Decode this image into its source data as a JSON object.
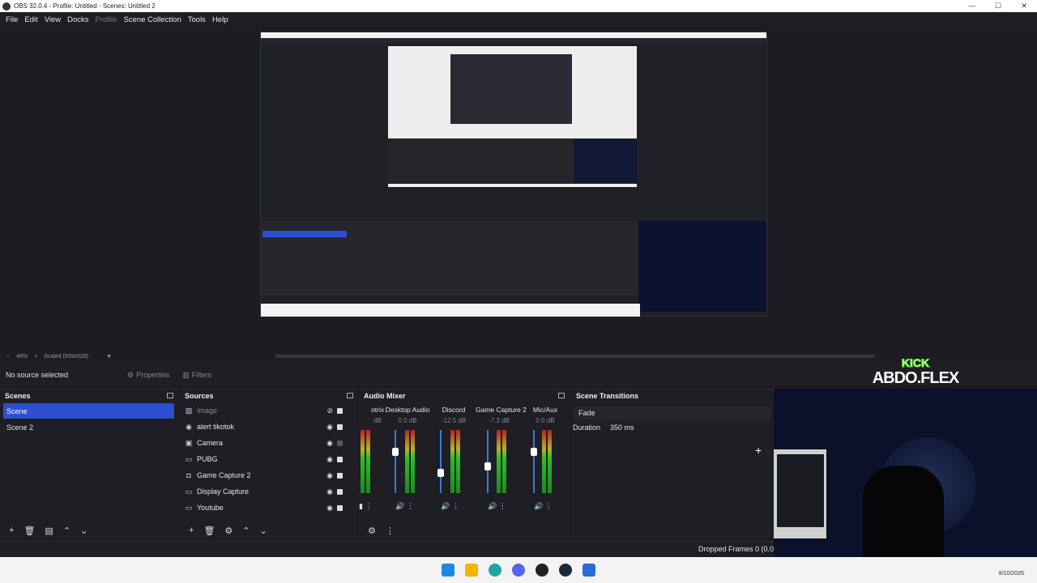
{
  "window": {
    "title": "OBS 32.0.4 - Profile: Untitled - Scenes: Untitled 2",
    "minimize": "—",
    "maximize": "☐",
    "close": "✕"
  },
  "menu": [
    "File",
    "Edit",
    "View",
    "Docks",
    "Profile",
    "Scene Collection",
    "Tools",
    "Help"
  ],
  "zoom": {
    "minus": "−",
    "percent": "48%",
    "plus": "+",
    "scaled": "Scaled (939x528)",
    "arrow": "▼"
  },
  "status_row": {
    "no_source": "No source selected",
    "properties": "Properties",
    "filters": "Filters"
  },
  "scenes": {
    "title": "Scenes",
    "items": [
      "Scene",
      "Scene 2"
    ],
    "selected": "Scene"
  },
  "sources": {
    "title": "Sources",
    "items": [
      {
        "name": "Image",
        "icon": "image-icon",
        "visible": false,
        "locked": true
      },
      {
        "name": "alert tikotok",
        "icon": "browser-icon",
        "visible": true,
        "locked": true
      },
      {
        "name": "Camera",
        "icon": "camera-icon",
        "visible": true,
        "locked": false
      },
      {
        "name": "PUBG",
        "icon": "window-icon",
        "visible": true,
        "locked": true
      },
      {
        "name": "Game Capture 2",
        "icon": "gamepad-icon",
        "visible": true,
        "locked": true
      },
      {
        "name": "Display Capture",
        "icon": "monitor-icon",
        "visible": true,
        "locked": true
      },
      {
        "name": "Youtube",
        "icon": "window-icon",
        "visible": true,
        "locked": true
      }
    ]
  },
  "mixer": {
    "title": "Audio Mixer",
    "channels": [
      {
        "name": "otrix",
        "db": "dB"
      },
      {
        "name": "Desktop Audio",
        "db": "0.0 dB"
      },
      {
        "name": "Discord",
        "db": "-12.5 dB"
      },
      {
        "name": "Game Capture 2",
        "db": "-7.3 dB"
      },
      {
        "name": "Mic/Aux",
        "db": "0.0 dB"
      }
    ]
  },
  "transitions": {
    "title": "Scene Transitions",
    "selected": "Fade",
    "duration_label": "Duration",
    "duration_value": "350 ms",
    "add": "+"
  },
  "overlay": {
    "kick": "KICK",
    "name": "ABDO.FLEX"
  },
  "bottom": {
    "dropped": "Dropped Frames 0 (0.0"
  },
  "clock": "8/10/2026",
  "colors": {
    "accent": "#2d4fd0",
    "kick_green": "#53fc18"
  }
}
